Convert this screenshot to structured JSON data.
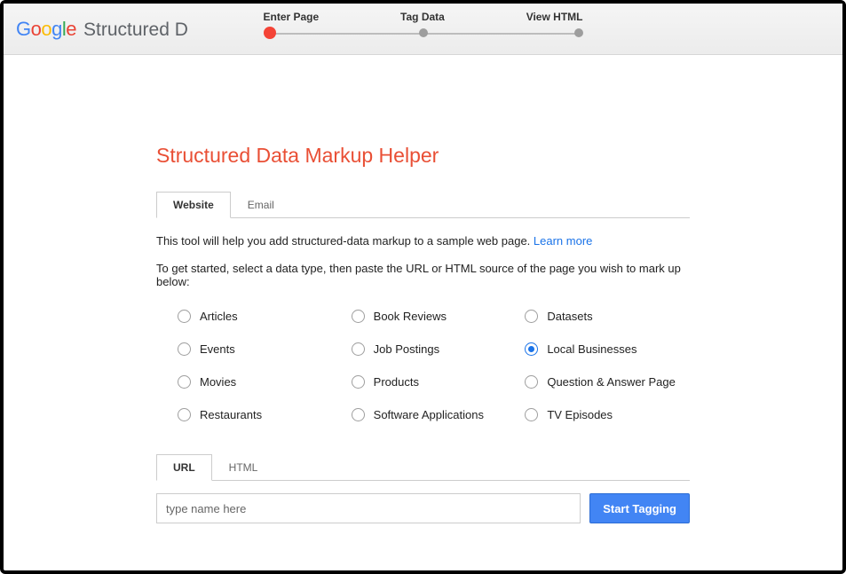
{
  "header": {
    "logo": {
      "g1": "G",
      "o1": "o",
      "o2": "o",
      "g2": "g",
      "l": "l",
      "e": "e"
    },
    "product_name": "Structured D",
    "steps": [
      "Enter Page",
      "Tag Data",
      "View HTML"
    ]
  },
  "page": {
    "title": "Structured Data Markup Helper",
    "tabs_primary": {
      "active": "Website",
      "inactive": "Email"
    },
    "intro_line1": "This tool will help you add structured-data markup to a sample web page. ",
    "learn_more": "Learn more",
    "intro_line2": "To get started, select a data type, then paste the URL or HTML source of the page you wish to mark up below:",
    "options": [
      {
        "label": "Articles",
        "checked": false
      },
      {
        "label": "Book Reviews",
        "checked": false
      },
      {
        "label": "Datasets",
        "checked": false
      },
      {
        "label": "Events",
        "checked": false
      },
      {
        "label": "Job Postings",
        "checked": false
      },
      {
        "label": "Local Businesses",
        "checked": true
      },
      {
        "label": "Movies",
        "checked": false
      },
      {
        "label": "Products",
        "checked": false
      },
      {
        "label": "Question & Answer Page",
        "checked": false
      },
      {
        "label": "Restaurants",
        "checked": false
      },
      {
        "label": "Software Applications",
        "checked": false
      },
      {
        "label": "TV Episodes",
        "checked": false
      }
    ],
    "tabs_secondary": {
      "active": "URL",
      "inactive": "HTML"
    },
    "input_placeholder": "type name here",
    "start_button": "Start Tagging"
  }
}
